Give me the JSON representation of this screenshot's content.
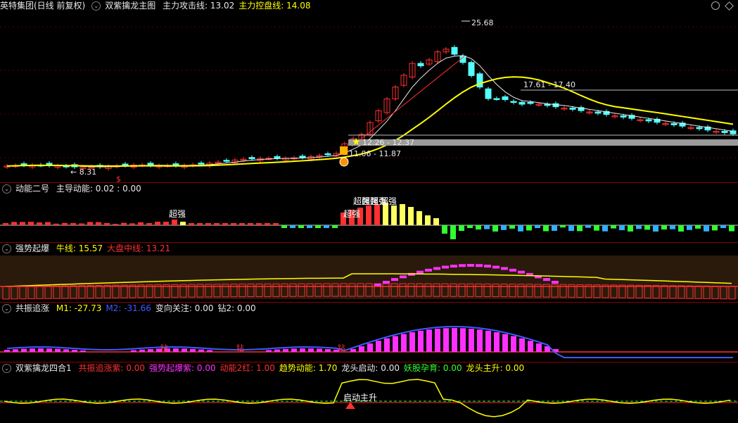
{
  "main": {
    "stock": "英特集团(日线 前复权)",
    "indicator": "双紫擒龙主图",
    "lines": [
      {
        "label": "主力攻击线:",
        "value": "13.02",
        "color": "#e8e8e8"
      },
      {
        "label": "主力控盘线:",
        "value": "14.08",
        "color": "#ffff00"
      }
    ],
    "annotations": {
      "peak": "25.68",
      "low": "← 8.31",
      "range1": "17.61 - 17.40",
      "range2": "12.26 - 12.37",
      "range3": "11.06 - 11.87",
      "dollar": "$"
    }
  },
  "panel2": {
    "name": "动能二号",
    "vals": [
      {
        "label": "主导动能:",
        "value": "0.02 : 0.00",
        "color": "#e8e8e8"
      }
    ],
    "labels": [
      "超强",
      "超强",
      "超强",
      "超强",
      "超强",
      "超强"
    ]
  },
  "panel3": {
    "name": "强势起爆",
    "vals": [
      {
        "label": "牛线:",
        "value": "15.57",
        "color": "#ffff00"
      },
      {
        "label": "大盘中线:",
        "value": "13.21",
        "color": "#ff3030"
      }
    ]
  },
  "panel4": {
    "name": "共振追涨",
    "vals": [
      {
        "label": "M1:",
        "value": "-27.73",
        "color": "#ffff00"
      },
      {
        "label": "M2:",
        "value": "-31.66",
        "color": "#3c5cff"
      },
      {
        "label": "变向关注:",
        "value": "0.00",
        "color": "#e8e8e8"
      },
      {
        "label": "钻2:",
        "value": "0.00",
        "color": "#e8e8e8"
      }
    ],
    "marks": [
      "钻",
      "钻",
      "钻"
    ]
  },
  "panel5": {
    "name": "双紫擒龙四合1",
    "vals": [
      {
        "label": "共振追涨紫:",
        "value": "0.00",
        "color": "#ff3030"
      },
      {
        "label": "强势起爆紫:",
        "value": "0.00",
        "color": "#ff30ff"
      },
      {
        "label": "动能2红:",
        "value": "1.00",
        "color": "#ff3030"
      },
      {
        "label": "趋势动能:",
        "value": "1.70",
        "color": "#ffff00"
      },
      {
        "label": "龙头启动:",
        "value": "0.00",
        "color": "#e8e8e8"
      },
      {
        "label": "妖股孕育:",
        "value": "0.00",
        "color": "#30ff30"
      },
      {
        "label": "龙头主升:",
        "value": "0.00",
        "color": "#ffff00"
      }
    ],
    "mark": "启动主升"
  }
}
